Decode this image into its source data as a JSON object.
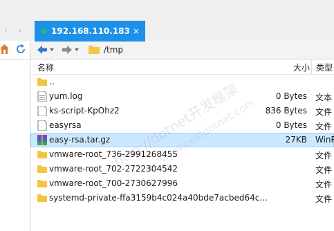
{
  "tab": {
    "title": "192.168.110.183",
    "close": "×"
  },
  "toolbar": {
    "path": "/tmp"
  },
  "columns": {
    "name": "名称",
    "size": "大小",
    "type": "类型"
  },
  "files": [
    {
      "name": "..",
      "size": "",
      "type": "",
      "icon": "folder-up-icon"
    },
    {
      "name": "yum.log",
      "size": "0 Bytes",
      "type": "文本",
      "icon": "text-file-icon"
    },
    {
      "name": "ks-script-KpOhz2",
      "size": "836 Bytes",
      "type": "文件",
      "icon": "file-icon"
    },
    {
      "name": "easyrsa",
      "size": "0 Bytes",
      "type": "文件",
      "icon": "file-icon"
    },
    {
      "name": "easy-rsa.tar.gz",
      "size": "27KB",
      "type": "WinR",
      "icon": "archive-icon"
    },
    {
      "name": "vmware-root_736-2991268455",
      "size": "",
      "type": "文件",
      "icon": "folder-icon"
    },
    {
      "name": "vmware-root_702-2722304542",
      "size": "",
      "type": "文件",
      "icon": "folder-icon"
    },
    {
      "name": "vmware-root_700-2730627996",
      "size": "",
      "type": "文件",
      "icon": "folder-icon"
    },
    {
      "name": "systemd-private-ffa3159b4c024a40bde7acbed64c...",
      "size": "",
      "type": "文件",
      "icon": "folder-icon"
    }
  ],
  "watermark": {
    "line1": "http://dotnet开发框架",
    "line2": "www.bestdotnet.com"
  },
  "colors": {
    "tab": "#1e90e8",
    "selected": "#cce8ff",
    "folder": "#f4c542"
  }
}
